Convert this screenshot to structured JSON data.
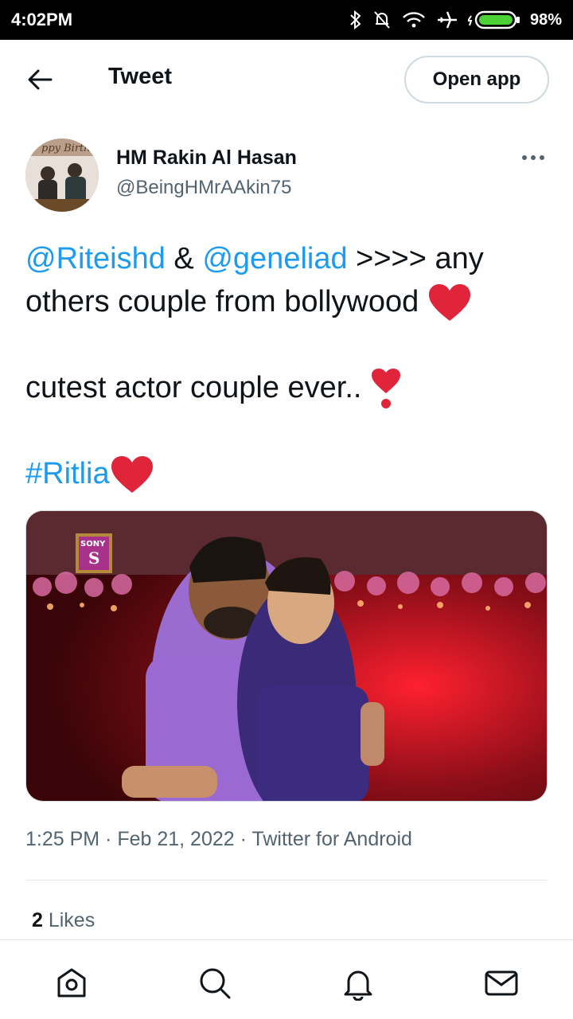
{
  "status_bar": {
    "time": "4:02PM",
    "battery": "98%"
  },
  "header": {
    "title": "Tweet",
    "open_app": "Open app"
  },
  "author": {
    "name": "HM Rakin Al Hasan",
    "handle": "@BeingHMrAAkin75"
  },
  "tweet": {
    "mention1": "@Riteishd",
    "amp": " & ",
    "mention2": "@geneliad",
    "line1_rest": " >>>> any",
    "line2": "others couple from bollywood ",
    "line4": "cutest actor couple ever.. ",
    "hashtag": "#Ritlia"
  },
  "meta": {
    "time": "1:25 PM",
    "sep1": " · ",
    "date": "Feb 21, 2022",
    "sep2": " · ",
    "source": "Twitter for Android"
  },
  "likes": {
    "count": "2",
    "label": " Likes"
  },
  "icons": [
    "back-arrow-icon",
    "more-icon",
    "home-icon",
    "search-icon",
    "notifications-icon",
    "messages-icon"
  ],
  "colors": {
    "link": "#1d9bf0",
    "heart": "#e0243a",
    "text": "#0f1419",
    "secondary": "#536471"
  }
}
